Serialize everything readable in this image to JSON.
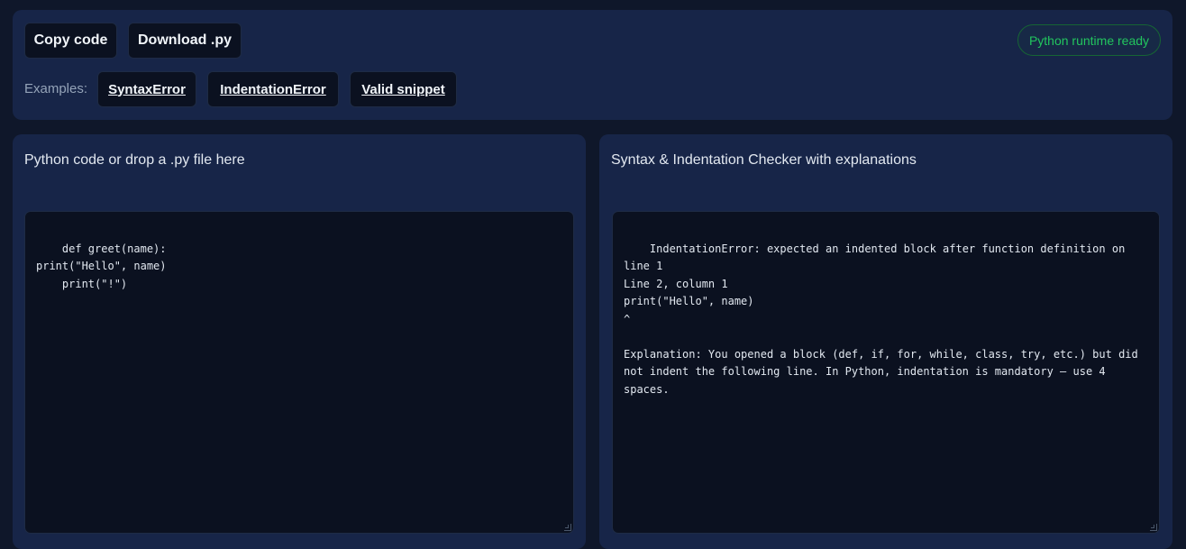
{
  "toolbar": {
    "copy_label": "Copy code",
    "download_label": "Download .py",
    "examples_label": "Examples:",
    "examples": [
      "SyntaxError",
      "IndentationError",
      "Valid snippet"
    ],
    "status": "Python runtime ready"
  },
  "editor": {
    "title": "Python code or drop a .py file here",
    "code": "def greet(name):\nprint(\"Hello\", name)\n    print(\"!\")"
  },
  "output": {
    "title": "Syntax & Indentation Checker with explanations",
    "text": "IndentationError: expected an indented block after function definition on line 1\nLine 2, column 1\nprint(\"Hello\", name)\n^\n\nExplanation: You opened a block (def, if, for, while, class, try, etc.) but did not indent the following line. In Python, indentation is mandatory — use 4 spaces."
  },
  "colors": {
    "background": "#0f172a",
    "panel": "#172548",
    "code_bg": "#0b1120",
    "status_green": "#22c55e"
  }
}
